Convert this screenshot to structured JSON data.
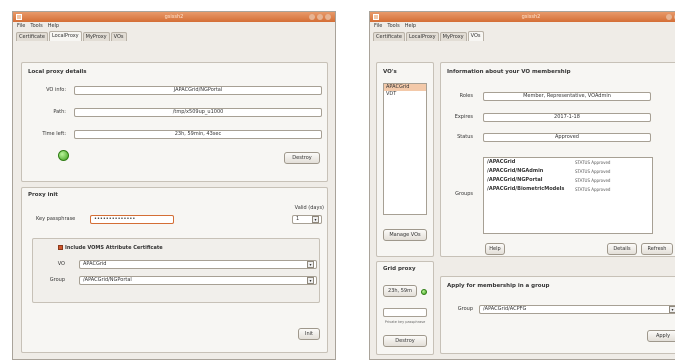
{
  "window_title": "gsissh2",
  "menu": [
    "File",
    "Tools",
    "Help"
  ],
  "tabs": [
    "Certificate",
    "LocalProxy",
    "MyProxy",
    "VOs"
  ],
  "w1": {
    "local_proxy_title": "Local proxy details",
    "vo_info_label": "VO info:",
    "vo_info_value": "JAPACGrid/NGPortal",
    "path_label": "Path:",
    "path_value": "/tmp/x509up_u1000",
    "time_left_label": "Time left:",
    "time_left_value": "23h, 59min, 43sec",
    "destroy_label": "Destroy",
    "proxy_init_title": "Proxy init",
    "valid_days_label": "Valid (days)",
    "key_passphrase_label": "Key passphrase",
    "key_passphrase_value": "••••••••••••••",
    "valid_days_value": "1",
    "include_voms_label": "Include VOMS Attribute Certificate",
    "vo_label": "VO",
    "vo_value": "APACGrid",
    "group_label": "Group",
    "group_value": "/APACGrid/NGPortal",
    "init_label": "Init"
  },
  "w2": {
    "vos_title": "VO's",
    "vo_list": [
      "APACGrid",
      "VDT"
    ],
    "manage_vos_label": "Manage VOs",
    "info_title": "Information about your VO membership",
    "roles_label": "Roles",
    "roles_value": "Member, Representative, VOAdmin",
    "expires_label": "Expires",
    "expires_value": "2017-1-18",
    "status_label": "Status",
    "status_value": "Approved",
    "groups_label": "Groups",
    "groups": [
      {
        "name": "/APACGrid",
        "status": "STATUS Approved"
      },
      {
        "name": "/APACGrid/NGAdmin",
        "status": "STATUS Approved"
      },
      {
        "name": "/APACGrid/NGPortal",
        "status": "STATUS Approved"
      },
      {
        "name": "/APACGrid/BiometricModels",
        "status": "STATUS Approved"
      }
    ],
    "help_label": "Help",
    "details_label": "Details",
    "refresh_label": "Refresh",
    "grid_proxy_title": "Grid proxy",
    "grid_proxy_time": "23h, 59m",
    "private_key_label": "Private key passphrase",
    "destroy_label": "Destroy",
    "apply_title": "Apply for membership in a group",
    "apply_group_label": "Group",
    "apply_group_value": "/APACGrid/ACPFG",
    "apply_label": "Apply"
  }
}
